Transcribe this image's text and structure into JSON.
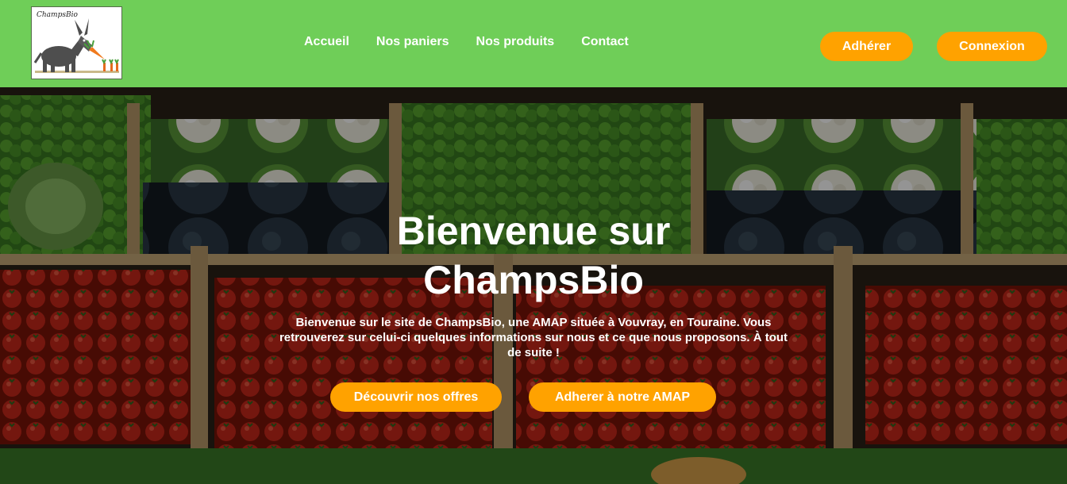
{
  "header": {
    "logo_text": "ChampsBio",
    "nav": [
      {
        "label": "Accueil"
      },
      {
        "label": "Nos paniers"
      },
      {
        "label": "Nos produits"
      },
      {
        "label": "Contact"
      }
    ],
    "join_button": "Adhérer",
    "login_button": "Connexion"
  },
  "hero": {
    "title": "Bienvenue sur ChampsBio",
    "text": "Bienvenue sur le site de ChampsBio, une AMAP située à Vouvray, en Touraine. Vous retrouverez sur celui-ci quelques informations sur nous et ce que nous proposons. À tout de suite !",
    "offers_button": "Découvrir nos offres",
    "join_amap_button": "Adherer à notre AMAP"
  },
  "colors": {
    "header_bg": "#6fce58",
    "button_bg": "#ffa200",
    "button_text": "#ffffff"
  }
}
